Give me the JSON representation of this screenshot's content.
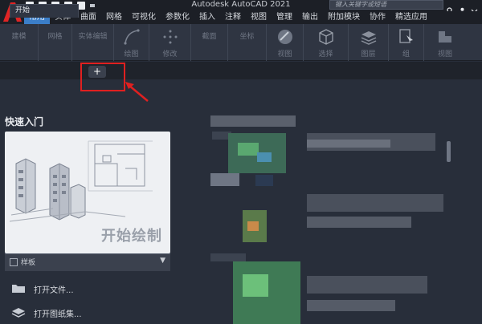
{
  "titlebar": {
    "app_title": "Autodesk AutoCAD 2021",
    "search_placeholder": "键入关键字或短语"
  },
  "ribbon_tabs": [
    "常用",
    "实体",
    "曲面",
    "网格",
    "可视化",
    "参数化",
    "插入",
    "注释",
    "视图",
    "管理",
    "输出",
    "附加模块",
    "协作",
    "精选应用"
  ],
  "ribbon_panels": [
    {
      "label": "建模"
    },
    {
      "label": "网格"
    },
    {
      "label": "实体编辑"
    },
    {
      "label": "绘图"
    },
    {
      "label": "修改"
    },
    {
      "label": "截面"
    },
    {
      "label": "坐标"
    },
    {
      "label": "视图"
    },
    {
      "label": "选择"
    },
    {
      "label": "图层"
    },
    {
      "label": "组"
    },
    {
      "label": "视图"
    }
  ],
  "doc_tabs": {
    "start_label": "开始",
    "new_tab_label": "+"
  },
  "start_page": {
    "quick_start_title": "快速入门",
    "start_drawing_label": "开始绘制",
    "template_label": "样板",
    "dropdown_arrow": "▼",
    "open_files_label": "打开文件...",
    "open_sheet_set_label": "打开图纸集..."
  },
  "colors": {
    "accent": "#3b7ec8",
    "highlight_box": "#e02020",
    "background": "#282e3a"
  },
  "icons": {
    "logo": "autocad-logo-icon",
    "open_folder": "folder-icon",
    "sheet_set": "sheet-stack-icon"
  }
}
